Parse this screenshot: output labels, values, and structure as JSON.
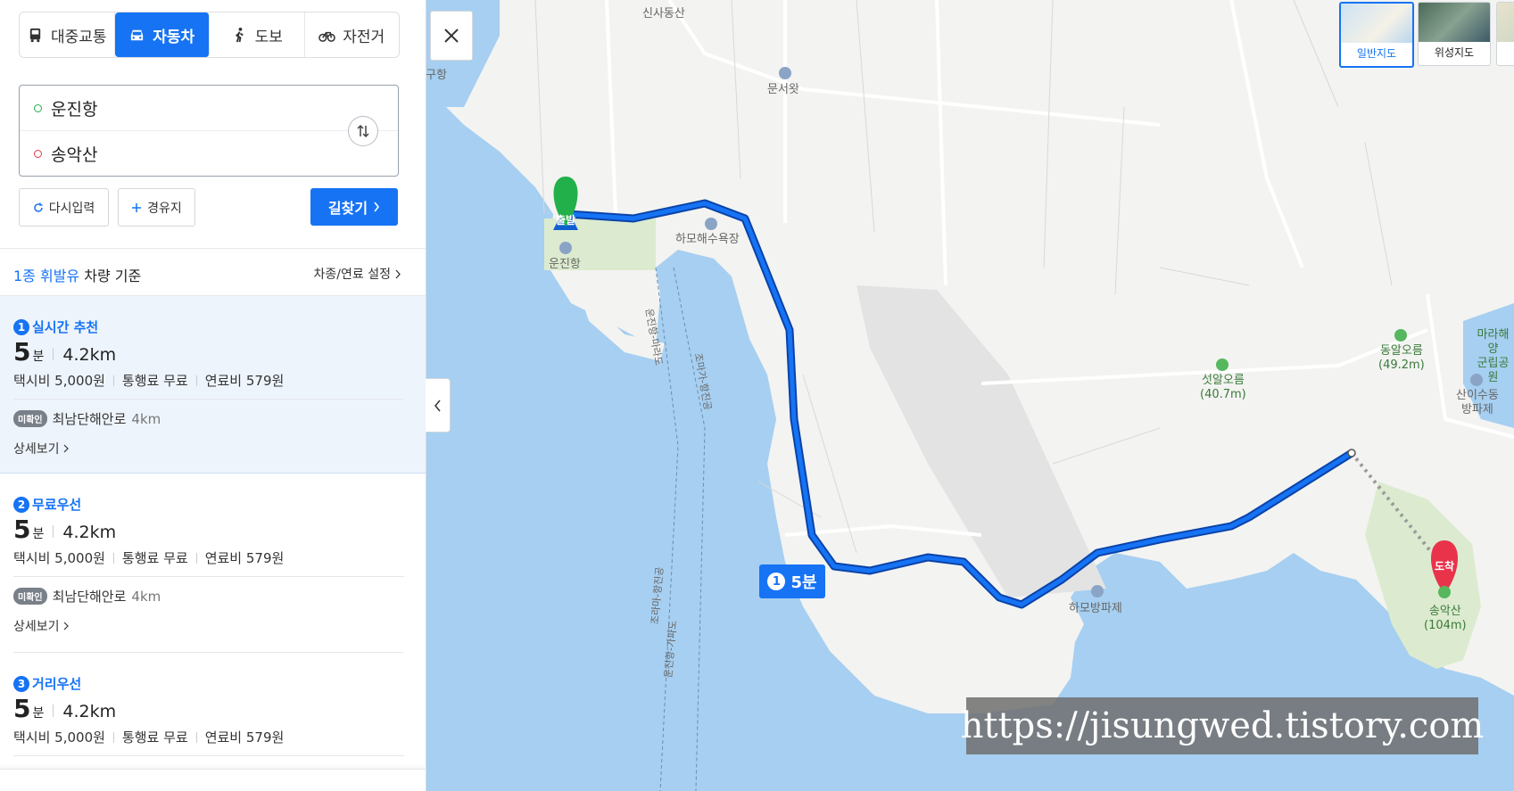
{
  "modes": [
    {
      "label": "대중교통",
      "icon": "bus-icon",
      "active": false
    },
    {
      "label": "자동차",
      "icon": "car-icon",
      "active": true
    },
    {
      "label": "도보",
      "icon": "walk-icon",
      "active": false
    },
    {
      "label": "자전거",
      "icon": "bicycle-icon",
      "active": false
    }
  ],
  "search": {
    "origin": "운진항",
    "destination": "송악산",
    "reset_label": "다시입력",
    "waypoint_label": "경유지",
    "go_label": "길찾기"
  },
  "basis": {
    "highlight": "1종 휘발유",
    "text": "차량 기준",
    "setting_label": "차종/연료 설정"
  },
  "routes": [
    {
      "num": "1",
      "name": "실시간 추천",
      "time": "5",
      "time_unit": "분",
      "distance": "4.2km",
      "taxi": "택시비 5,000원",
      "toll": "통행료 무료",
      "fuel": "연료비 579원",
      "badge": "미확인",
      "road": "최남단해안로",
      "road_km": "4km",
      "detail": "상세보기"
    },
    {
      "num": "2",
      "name": "무료우선",
      "time": "5",
      "time_unit": "분",
      "distance": "4.2km",
      "taxi": "택시비 5,000원",
      "toll": "통행료 무료",
      "fuel": "연료비 579원",
      "badge": "미확인",
      "road": "최남단해안로",
      "road_km": "4km",
      "detail": "상세보기"
    },
    {
      "num": "3",
      "name": "거리우선",
      "time": "5",
      "time_unit": "분",
      "distance": "4.2km",
      "taxi": "택시비 5,000원",
      "toll": "통행료 무료",
      "fuel": "연료비 579원"
    }
  ],
  "map": {
    "map_types": [
      "일반지도",
      "위성지도"
    ],
    "pins": {
      "start": "출발",
      "end": "도착"
    },
    "time_badge": {
      "num": "1",
      "label": "5분"
    },
    "pois": {
      "sinsa": "신사동산",
      "munseo": "문서왓",
      "unjin": "운진항",
      "hamobeach": "하모해수욕장",
      "seodal_name": "섯알오름",
      "seodal_height": "(40.7m)",
      "dongal_name": "동알오름",
      "dongal_height": "(49.2m)",
      "hamo_breakwater": "하모방파제",
      "sanisu_1": "산이수동",
      "sanisu_2": "방파제",
      "marado_1": "마라해양",
      "marado_2": "군립공원",
      "songak_name": "송악산",
      "songak_height": "(104m)",
      "ferry1": "운진항-마라도",
      "ferry2": "조마가-항진공",
      "ferry3": "조라마-항진공",
      "ferry4": "운진항-가파도",
      "edge_left": "구항"
    },
    "watermark": "https://jisungwed.tistory.com"
  },
  "colors": {
    "accent": "#1673f4",
    "route": "#0f5fd0",
    "sea": "#a6cff1",
    "land": "#f3f3f1",
    "park": "#dcebcf",
    "start_pin": "#22b04b",
    "end_pin": "#e8334b"
  }
}
